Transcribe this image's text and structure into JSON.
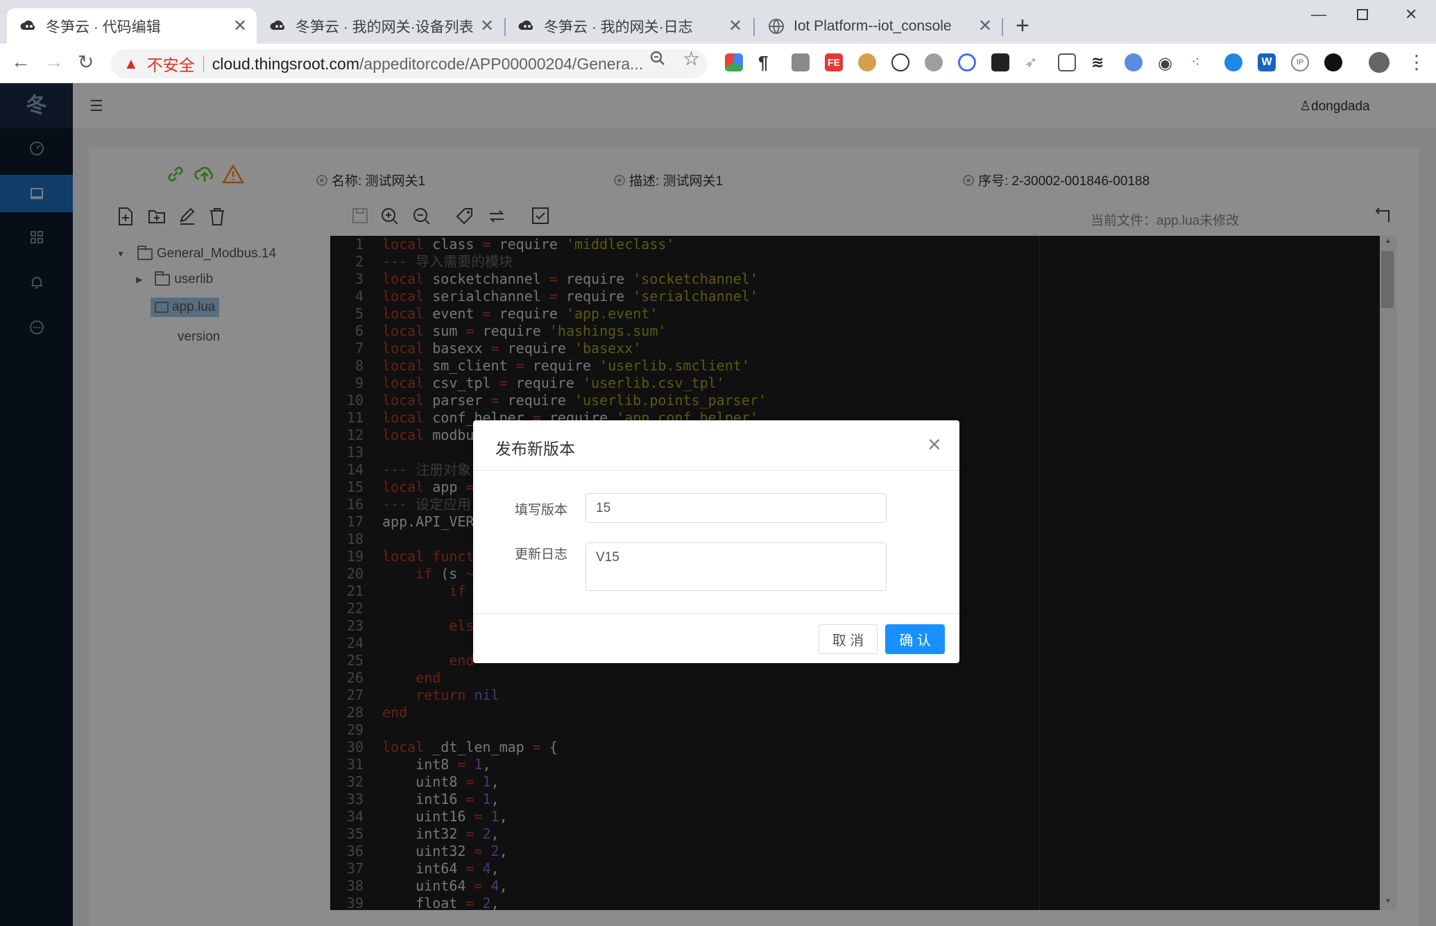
{
  "browser": {
    "tabs": [
      {
        "title": "冬笋云 · 代码编辑",
        "active": true
      },
      {
        "title": "冬笋云 · 我的网关·设备列表",
        "active": false
      },
      {
        "title": "冬笋云 · 我的网关·日志",
        "active": false
      },
      {
        "title": "Iot Platform--iot_console",
        "active": false
      }
    ],
    "security_label": "不安全",
    "url_host": "cloud.thingsroot.com",
    "url_path": "/appeditorcode/APP00000204/Genera..."
  },
  "app": {
    "logo": "冬",
    "user": "dongdada",
    "sidebar_items": [
      {
        "icon": "dashboard-icon",
        "active": false
      },
      {
        "icon": "monitor-icon",
        "active": true
      },
      {
        "icon": "apps-grid-icon",
        "active": false
      },
      {
        "icon": "bell-icon",
        "active": false
      },
      {
        "icon": "chat-icon",
        "active": false
      }
    ]
  },
  "gateway_info": {
    "name": "名称: 测试网关1",
    "description": "描述: 测试网关1",
    "serial": "序号: 2-30002-001846-00188"
  },
  "editor": {
    "current_file": "当前文件：app.lua未修改",
    "tree": {
      "root": "General_Modbus.14",
      "folder": "userlib",
      "selected_file": "app.lua",
      "file": "version"
    }
  },
  "dialog": {
    "title": "发布新版本",
    "version_label": "填写版本",
    "version_value": "15",
    "changelog_label": "更新日志",
    "changelog_value": "V15",
    "cancel_label": "取 消",
    "confirm_label": "确 认"
  },
  "code_lines": [
    [
      [
        "kw",
        "local"
      ],
      [
        "id",
        " class "
      ],
      [
        "op",
        "="
      ],
      [
        "id",
        " require "
      ],
      [
        "st",
        "'middleclass'"
      ]
    ],
    [
      [
        "cm",
        "--- 导入需要的模块"
      ]
    ],
    [
      [
        "kw",
        "local"
      ],
      [
        "id",
        " socketchannel "
      ],
      [
        "op",
        "="
      ],
      [
        "id",
        " require "
      ],
      [
        "st",
        "'socketchannel'"
      ]
    ],
    [
      [
        "kw",
        "local"
      ],
      [
        "id",
        " serialchannel "
      ],
      [
        "op",
        "="
      ],
      [
        "id",
        " require "
      ],
      [
        "st",
        "'serialchannel'"
      ]
    ],
    [
      [
        "kw",
        "local"
      ],
      [
        "id",
        " event "
      ],
      [
        "op",
        "="
      ],
      [
        "id",
        " require "
      ],
      [
        "st",
        "'app.event'"
      ]
    ],
    [
      [
        "kw",
        "local"
      ],
      [
        "id",
        " sum "
      ],
      [
        "op",
        "="
      ],
      [
        "id",
        " require "
      ],
      [
        "st",
        "'hashings.sum'"
      ]
    ],
    [
      [
        "kw",
        "local"
      ],
      [
        "id",
        " basexx "
      ],
      [
        "op",
        "="
      ],
      [
        "id",
        " require "
      ],
      [
        "st",
        "'basexx'"
      ]
    ],
    [
      [
        "kw",
        "local"
      ],
      [
        "id",
        " sm_client "
      ],
      [
        "op",
        "="
      ],
      [
        "id",
        " require "
      ],
      [
        "st",
        "'userlib.smclient'"
      ]
    ],
    [
      [
        "kw",
        "local"
      ],
      [
        "id",
        " csv_tpl "
      ],
      [
        "op",
        "="
      ],
      [
        "id",
        " require "
      ],
      [
        "st",
        "'userlib.csv_tpl'"
      ]
    ],
    [
      [
        "kw",
        "local"
      ],
      [
        "id",
        " parser "
      ],
      [
        "op",
        "="
      ],
      [
        "id",
        " require "
      ],
      [
        "st",
        "'userlib.points_parser'"
      ]
    ],
    [
      [
        "kw",
        "local"
      ],
      [
        "id",
        " conf_helper "
      ],
      [
        "op",
        "="
      ],
      [
        "id",
        " require "
      ],
      [
        "st",
        "'app.conf_helper'"
      ]
    ],
    [
      [
        "kw",
        "local"
      ],
      [
        "id",
        " modbu"
      ]
    ],
    [],
    [
      [
        "cm",
        "--- 注册对象"
      ]
    ],
    [
      [
        "kw",
        "local"
      ],
      [
        "id",
        " app "
      ],
      [
        "op",
        "="
      ]
    ],
    [
      [
        "cm",
        "--- 设定应用"
      ]
    ],
    [
      [
        "id",
        "app.API_VER"
      ]
    ],
    [],
    [
      [
        "kw",
        "local"
      ],
      [
        "kw",
        " funct"
      ]
    ],
    [
      [
        "id",
        "    "
      ],
      [
        "kw",
        "if"
      ],
      [
        "id",
        " (s "
      ],
      [
        "op",
        "~"
      ]
    ],
    [
      [
        "id",
        "        "
      ],
      [
        "kw",
        "if"
      ]
    ],
    [],
    [
      [
        "id",
        "        "
      ],
      [
        "kw",
        "els"
      ]
    ],
    [],
    [
      [
        "id",
        "        "
      ],
      [
        "kw",
        "end"
      ]
    ],
    [
      [
        "id",
        "    "
      ],
      [
        "kw",
        "end"
      ]
    ],
    [
      [
        "id",
        "    "
      ],
      [
        "kw",
        "return"
      ],
      [
        "id",
        " "
      ],
      [
        "num",
        "nil"
      ]
    ],
    [
      [
        "kw",
        "end"
      ]
    ],
    [],
    [
      [
        "kw",
        "local"
      ],
      [
        "id",
        " _dt_len_map "
      ],
      [
        "op",
        "="
      ],
      [
        "id",
        " {"
      ]
    ],
    [
      [
        "id",
        "    int8 "
      ],
      [
        "op",
        "="
      ],
      [
        "id",
        " "
      ],
      [
        "num",
        "1"
      ],
      [
        "id",
        ","
      ]
    ],
    [
      [
        "id",
        "    uint8 "
      ],
      [
        "op",
        "="
      ],
      [
        "id",
        " "
      ],
      [
        "num",
        "1"
      ],
      [
        "id",
        ","
      ]
    ],
    [
      [
        "id",
        "    int16 "
      ],
      [
        "op",
        "="
      ],
      [
        "id",
        " "
      ],
      [
        "num",
        "1"
      ],
      [
        "id",
        ","
      ]
    ],
    [
      [
        "id",
        "    uint16 "
      ],
      [
        "op",
        "="
      ],
      [
        "id",
        " "
      ],
      [
        "num",
        "1"
      ],
      [
        "id",
        ","
      ]
    ],
    [
      [
        "id",
        "    int32 "
      ],
      [
        "op",
        "="
      ],
      [
        "id",
        " "
      ],
      [
        "num",
        "2"
      ],
      [
        "id",
        ","
      ]
    ],
    [
      [
        "id",
        "    uint32 "
      ],
      [
        "op",
        "="
      ],
      [
        "id",
        " "
      ],
      [
        "num",
        "2"
      ],
      [
        "id",
        ","
      ]
    ],
    [
      [
        "id",
        "    int64 "
      ],
      [
        "op",
        "="
      ],
      [
        "id",
        " "
      ],
      [
        "num",
        "4"
      ],
      [
        "id",
        ","
      ]
    ],
    [
      [
        "id",
        "    uint64 "
      ],
      [
        "op",
        "="
      ],
      [
        "id",
        " "
      ],
      [
        "num",
        "4"
      ],
      [
        "id",
        ","
      ]
    ],
    [
      [
        "id",
        "    float "
      ],
      [
        "op",
        "="
      ],
      [
        "id",
        " "
      ],
      [
        "num",
        "2"
      ],
      [
        "id",
        ","
      ]
    ]
  ]
}
